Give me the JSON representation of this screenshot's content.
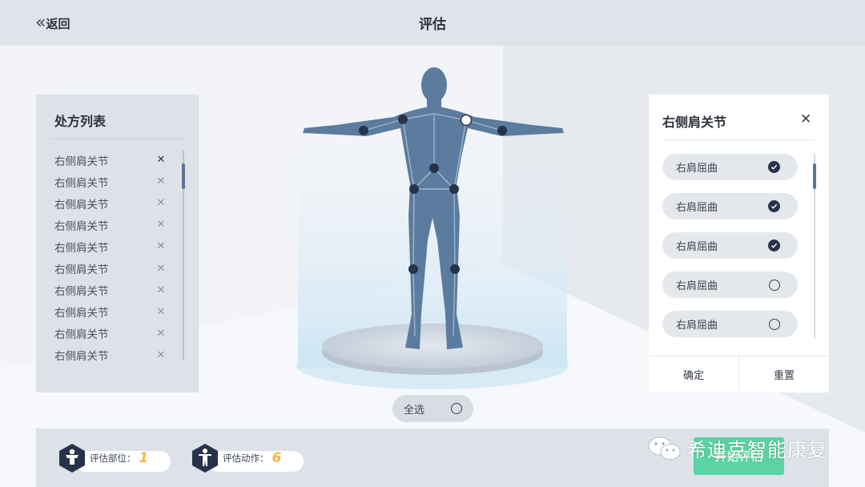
{
  "header": {
    "back_label": "返回",
    "title": "评估"
  },
  "prescription_list": {
    "title": "处方列表",
    "items": [
      "右侧肩关节",
      "右侧肩关节",
      "右侧肩关节",
      "右侧肩关节",
      "右侧肩关节",
      "右侧肩关节",
      "右侧肩关节",
      "右侧肩关节",
      "右侧肩关节",
      "右侧肩关节"
    ]
  },
  "body_model": {
    "select_all_label": "全选",
    "selected_joint": "right-shoulder"
  },
  "detail_panel": {
    "title": "右侧肩关节",
    "options": [
      {
        "label": "右肩屈曲",
        "checked": true
      },
      {
        "label": "右肩屈曲",
        "checked": true
      },
      {
        "label": "右肩屈曲",
        "checked": true
      },
      {
        "label": "右肩屈曲",
        "checked": false
      },
      {
        "label": "右肩屈曲",
        "checked": false
      }
    ],
    "confirm_label": "确定",
    "reset_label": "重置"
  },
  "footer": {
    "parts_label": "评估部位：",
    "parts_count": "1",
    "actions_label": "评估动作：",
    "actions_count": "6",
    "start_label": "开始评估"
  },
  "watermark": {
    "text": "希迪克智能康复"
  },
  "colors": {
    "accent": "#5bd3a5",
    "figure": "#5b7c9e",
    "count": "#f2b74a",
    "dark": "#27334a"
  }
}
